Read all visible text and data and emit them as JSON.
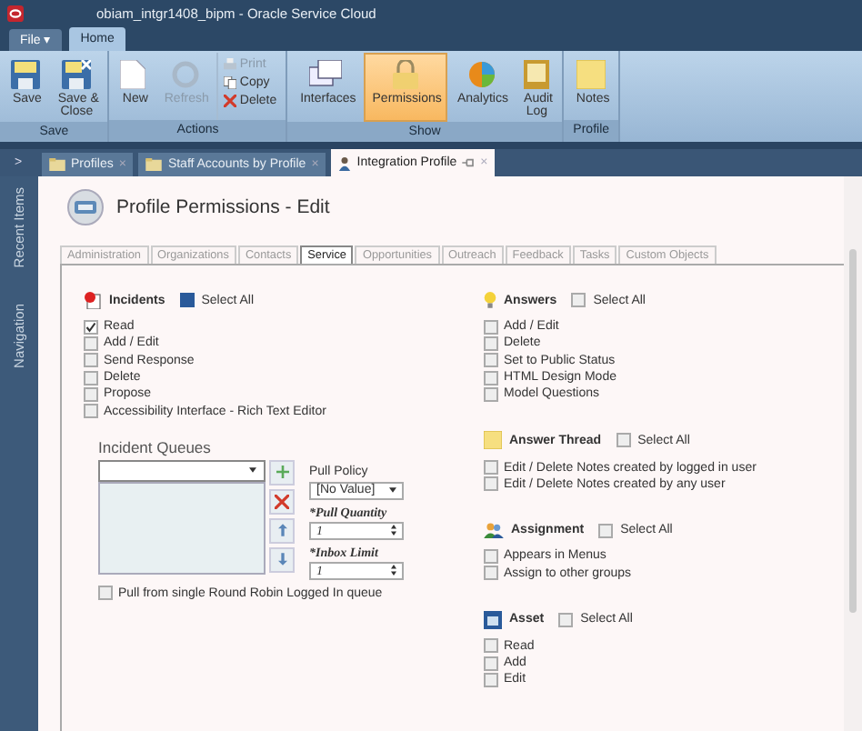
{
  "window": {
    "title": "obiam_intgr1408_bipm - Oracle Service Cloud"
  },
  "menu_tabs": [
    {
      "label": "File ▾",
      "selected": false
    },
    {
      "label": "Home",
      "selected": true
    }
  ],
  "ribbon": {
    "groups": [
      {
        "label": "Save",
        "buttons": [
          {
            "label": "Save",
            "kind": "large",
            "selected": false,
            "disabled": false
          },
          {
            "label": "Save &\nClose",
            "kind": "large",
            "selected": false,
            "disabled": false
          }
        ]
      },
      {
        "label": "Actions",
        "buttons": [
          {
            "label": "New",
            "kind": "large",
            "selected": false,
            "disabled": false
          },
          {
            "label": "Refresh",
            "kind": "large",
            "selected": false,
            "disabled": true
          },
          {
            "label": "Print",
            "kind": "small",
            "disabled": true
          },
          {
            "label": "Copy",
            "kind": "small",
            "disabled": false
          },
          {
            "label": "Delete",
            "kind": "small",
            "disabled": false
          }
        ]
      },
      {
        "label": "Show",
        "buttons": [
          {
            "label": "Interfaces",
            "kind": "large",
            "selected": false,
            "disabled": false
          },
          {
            "label": "Permissions",
            "kind": "large",
            "selected": true,
            "disabled": false
          },
          {
            "label": "Analytics",
            "kind": "large",
            "selected": false,
            "disabled": false
          },
          {
            "label": "Audit\nLog",
            "kind": "large",
            "selected": false,
            "disabled": false
          }
        ]
      },
      {
        "label": "Profile",
        "buttons": [
          {
            "label": "Notes",
            "kind": "large",
            "selected": false,
            "disabled": false
          }
        ]
      }
    ]
  },
  "doc_tabs": [
    {
      "label": "Profiles",
      "close": "×",
      "selected": false
    },
    {
      "label": "Staff Accounts by Profile",
      "close": "×",
      "selected": false
    },
    {
      "label": "Integration Profile",
      "close": "×",
      "selected": true
    }
  ],
  "sidebar": {
    "expander": ">",
    "items": [
      "Recent Items",
      "Navigation"
    ]
  },
  "page": {
    "title": "Profile Permissions - Edit"
  },
  "tabs": [
    {
      "label": "Administration",
      "selected": false
    },
    {
      "label": "Organizations",
      "selected": false
    },
    {
      "label": "Contacts",
      "selected": false
    },
    {
      "label": "Service",
      "selected": true
    },
    {
      "label": "Opportunities",
      "selected": false
    },
    {
      "label": "Outreach",
      "selected": false
    },
    {
      "label": "Feedback",
      "selected": false
    },
    {
      "label": "Tasks",
      "selected": false
    },
    {
      "label": "Custom Objects",
      "selected": false
    }
  ],
  "left_sections": [
    {
      "title": "Incidents",
      "select_all": {
        "label": "Select All",
        "checked": true
      },
      "items": [
        {
          "label": "Read",
          "checked": true
        },
        {
          "label": "Add / Edit",
          "checked": false
        },
        {
          "label": "Send Response",
          "checked": false
        },
        {
          "label": "Delete",
          "checked": false
        },
        {
          "label": "Propose",
          "checked": false
        },
        {
          "label": "Accessibility Interface - Rich Text Editor",
          "checked": false
        }
      ]
    }
  ],
  "incident_queues": {
    "label": "Incident Queues",
    "pull_policy": {
      "label": "Pull Policy",
      "value": "[No Value]"
    },
    "pull_quantity": {
      "label": "*Pull Quantity",
      "value": "1"
    },
    "inbox_limit": {
      "label": "*Inbox Limit",
      "value": "1"
    },
    "round_robin": {
      "label": "Pull from single Round Robin Logged In queue",
      "checked": false
    }
  },
  "right_sections": [
    {
      "title": "Answers",
      "select_all": {
        "label": "Select All",
        "checked": false
      },
      "items": [
        {
          "label": "Add / Edit",
          "checked": false
        },
        {
          "label": "Delete",
          "checked": false
        },
        {
          "label": "Set to Public Status",
          "checked": false
        },
        {
          "label": "HTML Design Mode",
          "checked": false
        },
        {
          "label": "Model Questions",
          "checked": false
        }
      ]
    },
    {
      "title": "Answer Thread",
      "select_all": {
        "label": "Select All",
        "checked": false
      },
      "items": [
        {
          "label": "Edit / Delete Notes created by logged in user",
          "checked": false
        },
        {
          "label": "Edit / Delete Notes created by any user",
          "checked": false
        }
      ]
    },
    {
      "title": "Assignment",
      "select_all": {
        "label": "Select All",
        "checked": false
      },
      "items": [
        {
          "label": "Appears in Menus",
          "checked": false
        },
        {
          "label": "Assign to other groups",
          "checked": false
        }
      ]
    },
    {
      "title": "Asset",
      "select_all": {
        "label": "Select All",
        "checked": false
      },
      "items": [
        {
          "label": "Read",
          "checked": false
        },
        {
          "label": "Add",
          "checked": false
        },
        {
          "label": "Edit",
          "checked": false
        }
      ]
    }
  ]
}
